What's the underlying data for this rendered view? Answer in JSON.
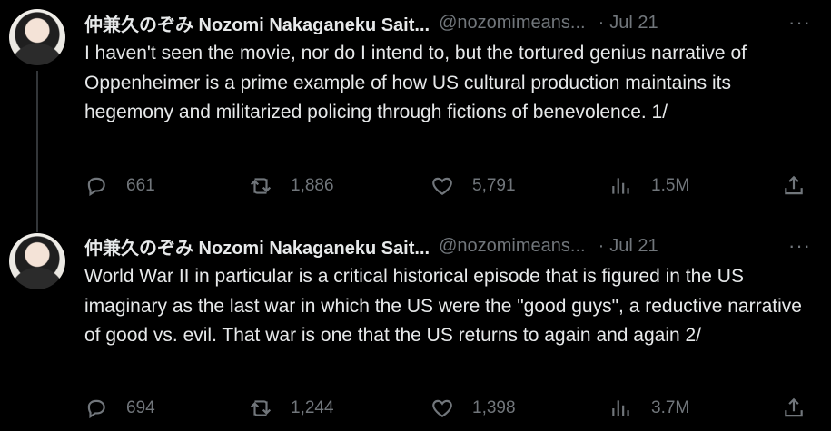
{
  "tweets": [
    {
      "author_name": "仲兼久のぞみ Nozomi Nakaganeku Sait...",
      "handle": "@nozomimeans...",
      "separator": "·",
      "date": "Jul 21",
      "more": "···",
      "text": "I haven't seen the movie, nor do I intend to, but the tortured genius narrative of Oppenheimer is a prime example of how US cultural production maintains its hegemony and militarized policing through fictions of benevolence. 1/",
      "replies": "661",
      "retweets": "1,886",
      "likes": "5,791",
      "views": "1.5M"
    },
    {
      "author_name": "仲兼久のぞみ Nozomi Nakaganeku Sait...",
      "handle": "@nozomimeans...",
      "separator": "·",
      "date": "Jul 21",
      "more": "···",
      "text": "World War II in particular is a critical historical episode that is figured in the US imaginary as the last war in which the US were the \"good guys\", a reductive narrative of good vs. evil. That war is one that the US returns to again and again 2/",
      "replies": "694",
      "retweets": "1,244",
      "likes": "1,398",
      "views": "3.7M"
    }
  ],
  "icons": {
    "reply": "reply-icon",
    "retweet": "retweet-icon",
    "like": "heart-icon",
    "views": "views-icon",
    "share": "share-icon"
  },
  "colors": {
    "background": "#000000",
    "text": "#e7e9ea",
    "muted": "#71767b",
    "thread_line": "#333639"
  }
}
